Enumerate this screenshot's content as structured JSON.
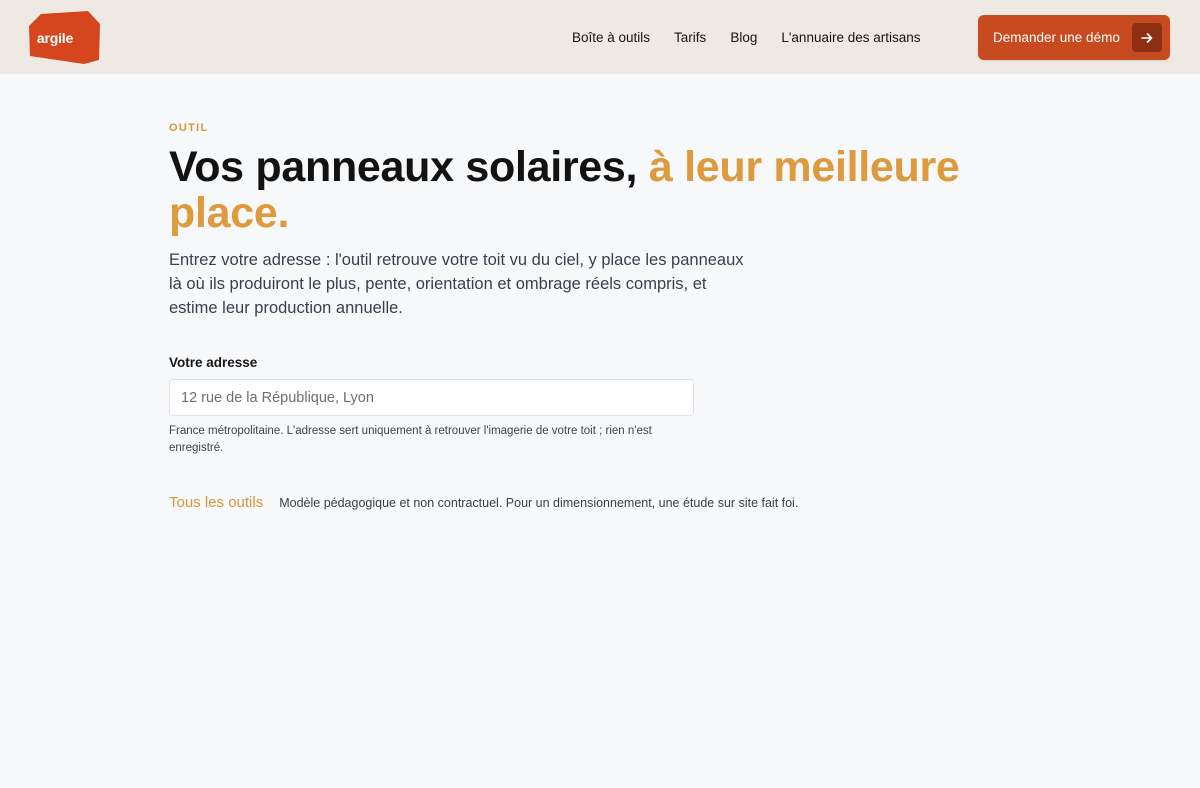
{
  "brand": {
    "logo_text": "argile",
    "color": "#d5461e"
  },
  "nav": {
    "items": [
      {
        "label": "Boîte à outils"
      },
      {
        "label": "Tarifs"
      },
      {
        "label": "Blog"
      },
      {
        "label": "L'annuaire des artisans"
      }
    ],
    "cta": {
      "label": "Demander une démo",
      "icon": "arrow-right-icon"
    }
  },
  "hero": {
    "eyebrow": "OUTIL",
    "title_main": "Vos panneaux solaires,",
    "title_accent": "à leur meilleure place.",
    "lead": "Entrez votre adresse : l'outil retrouve votre toit vu du ciel, y place les panneaux là où ils produiront le plus, pente, orientation et ombrage réels compris, et estime leur production annuelle."
  },
  "form": {
    "label": "Votre adresse",
    "placeholder": "12 rue de la République, Lyon",
    "value": "",
    "help": "France métropolitaine. L'adresse sert uniquement à retrouver l'imagerie de votre toit ; rien n'est enregistré."
  },
  "footer": {
    "all_tools": "Tous les outils",
    "disclaimer": "Modèle pédagogique et non contractuel. Pour un dimensionnement, une étude sur site fait foi."
  },
  "colors": {
    "accent": "#de9a3c",
    "cta": "#c84a1f",
    "cta_dark": "#8e2f13",
    "header_bg": "#efe9e4",
    "page_bg": "#f7f8fa"
  }
}
